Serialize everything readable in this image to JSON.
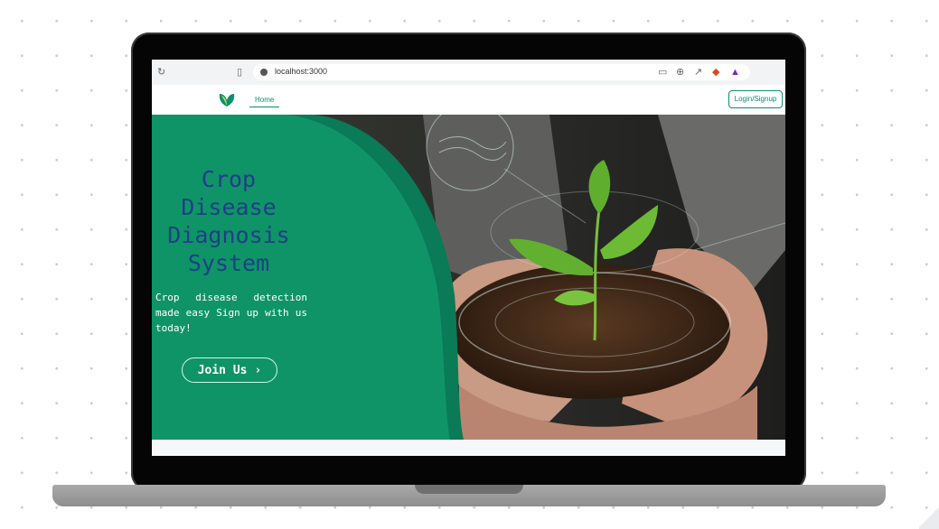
{
  "browser": {
    "url": "localhost:3000",
    "icons": [
      "reload-icon",
      "bookmark-icon",
      "site-info-icon",
      "cast-icon",
      "zoom-icon",
      "share-icon",
      "brave-shield-icon",
      "brave-rewards-icon"
    ]
  },
  "nav": {
    "home_label": "Home",
    "login_label": "Login/Signup"
  },
  "hero": {
    "title_line1": "Crop",
    "title_line2": "Disease",
    "title_line3": "Diagnosis",
    "title_line4": "System",
    "subtitle": "Crop disease detection made easy Sign up with us today!",
    "join_label": "Join Us",
    "join_icon": "chevron-right-icon"
  },
  "colors": {
    "brand_green": "#0b8f6a",
    "panel_green": "#0f9468",
    "panel_dark_green": "#0a7a57",
    "title_blue": "#1f3f86"
  }
}
